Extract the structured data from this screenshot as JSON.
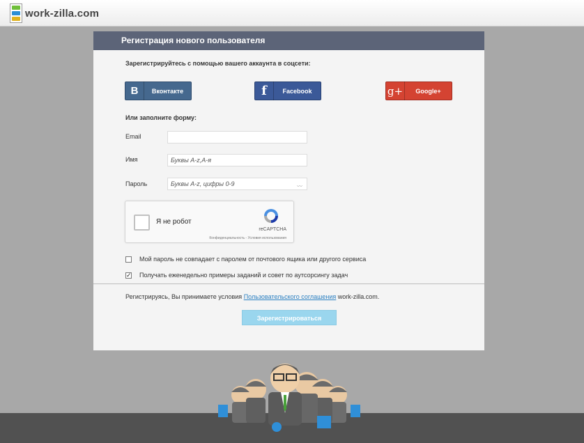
{
  "header": {
    "logo_text": "work-zilla.com"
  },
  "panel": {
    "title": "Регистрация нового пользователя",
    "social_title": "Зарегистрируйтесь с помощью вашего аккаунта в соцсети:",
    "social": {
      "vk": {
        "label": "Вконтакте",
        "icon": "B"
      },
      "facebook": {
        "label": "Facebook",
        "icon": "f"
      },
      "google": {
        "label": "Google+",
        "icon": "g+"
      }
    },
    "form_title": "Или заполните форму:",
    "fields": {
      "email": {
        "label": "Email",
        "value": ""
      },
      "name": {
        "label": "Имя",
        "placeholder": "Буквы A-z,А-я"
      },
      "password": {
        "label": "Пароль",
        "placeholder": "Буквы A-z, цифры 0-9"
      }
    },
    "captcha": {
      "label": "Я не робот",
      "brand": "reCAPTCHA",
      "links": "Конфиденциальность - Условия использования"
    },
    "checkboxes": [
      {
        "label": "Мой пароль не совпадает с паролем от почтового ящика или другого сервиса",
        "checked": false
      },
      {
        "label": "Получать еженедельно примеры заданий и совет по аутсорсингу задач",
        "checked": true
      }
    ],
    "agreement": {
      "prefix": "Регистрируясь, Вы принимаете условия ",
      "link": "Пользовательского соглашения",
      "suffix": " work-zilla.com."
    },
    "submit_label": "Зарегистрироваться"
  },
  "colors": {
    "header_bar": "#5c6478",
    "vk": "#45688e",
    "facebook": "#3b5998",
    "google": "#d44332",
    "submit": "#9ad6ee",
    "link": "#2a7fc1"
  }
}
